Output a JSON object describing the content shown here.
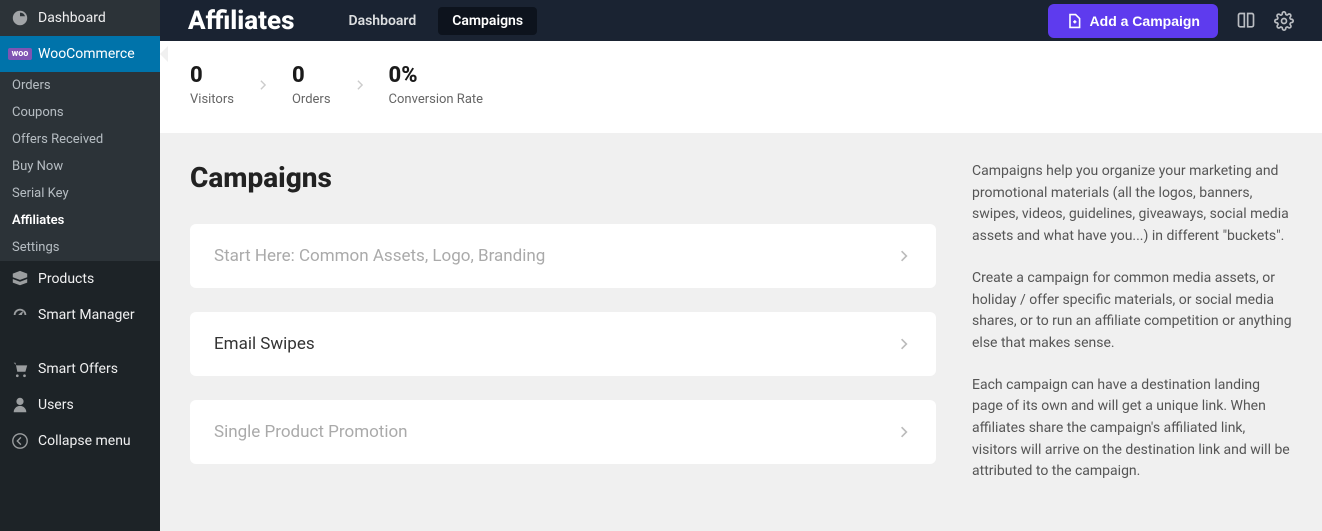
{
  "sidebar": {
    "dashboard": "Dashboard",
    "woocommerce": "WooCommerce",
    "sub": {
      "orders": "Orders",
      "coupons": "Coupons",
      "offers": "Offers Received",
      "buynow": "Buy Now",
      "serial": "Serial Key",
      "affiliates": "Affiliates",
      "settings": "Settings"
    },
    "products": "Products",
    "smartmanager": "Smart Manager",
    "smartoffers": "Smart Offers",
    "users": "Users",
    "collapse": "Collapse menu"
  },
  "topbar": {
    "brand": "Affiliates",
    "tab_dashboard": "Dashboard",
    "tab_campaigns": "Campaigns",
    "add_btn": "Add a Campaign"
  },
  "stats": {
    "visitors_val": "0",
    "visitors_lbl": "Visitors",
    "orders_val": "0",
    "orders_lbl": "Orders",
    "conv_val": "0%",
    "conv_lbl": "Conversion Rate"
  },
  "content": {
    "heading": "Campaigns",
    "card1": "Start Here: Common Assets, Logo, Branding",
    "card2": "Email Swipes",
    "card3": "Single Product Promotion",
    "help1": "Campaigns help you organize your marketing and promotional materials (all the logos, banners, swipes, videos, guidelines, giveaways, social media assets and what have you...) in different \"buckets\".",
    "help2": "Create a campaign for common media assets, or holiday / offer specific materials, or social media shares, or to run an affiliate competition or anything else that makes sense.",
    "help3": "Each campaign can have a destination landing page of its own and will get a unique link. When affiliates share the campaign's affiliated link, visitors will arrive on the destination link and will be attributed to the campaign."
  }
}
